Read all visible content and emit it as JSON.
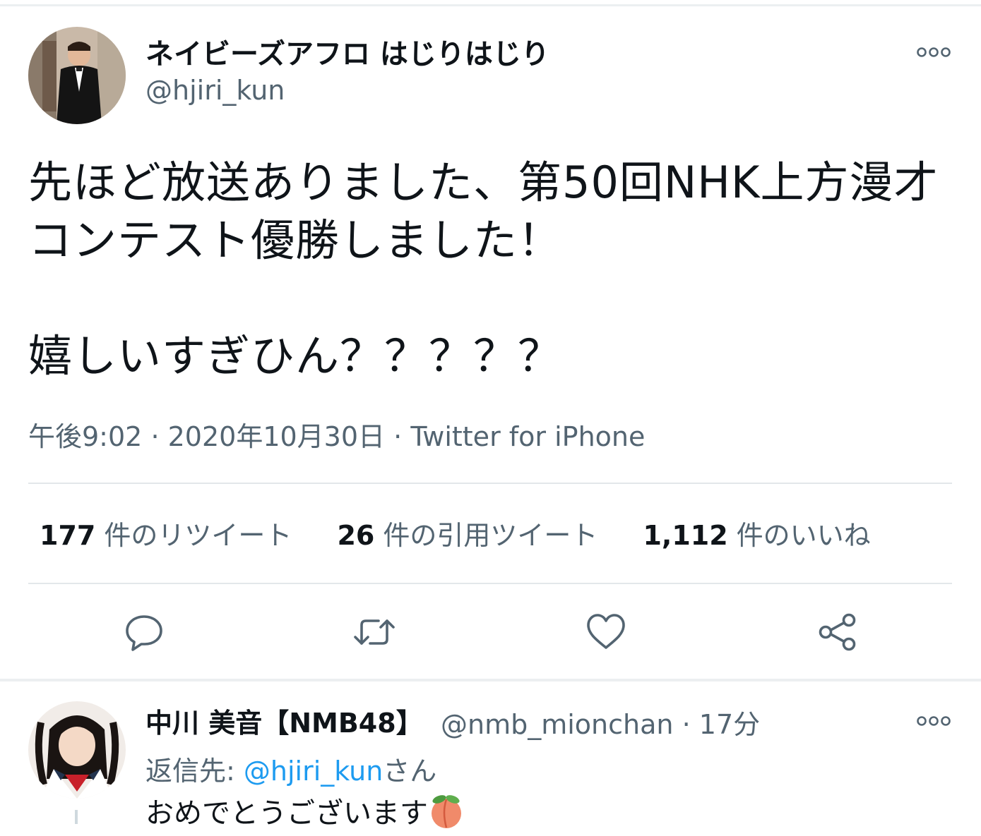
{
  "tweet": {
    "author_name": "ネイビーズアフロ はじりはじり",
    "author_handle": "@hjiri_kun",
    "text_lines": [
      "先ほど放送ありました、第50回NHK上方漫才",
      "コンテスト優勝しました！",
      "嬉しいすぎひん？？？？？"
    ],
    "time": "午後9:02",
    "date": "2020年10月30日",
    "source": "Twitter for iPhone",
    "separator": "·"
  },
  "stats": {
    "retweets_count": "177",
    "retweets_label": "件のリツイート",
    "quotes_count": "26",
    "quotes_label": "件の引用ツイート",
    "likes_count": "1,112",
    "likes_label": "件のいいね"
  },
  "actions": {
    "reply_icon": "reply-icon",
    "retweet_icon": "retweet-icon",
    "like_icon": "heart-icon",
    "share_icon": "share-icon"
  },
  "reply": {
    "author_name": "中川 美音【NMB48】",
    "author_handle": "@nmb_mionchan",
    "time_ago": "17分",
    "separator": "·",
    "reply_to_prefix": "返信先: ",
    "reply_to_mention": "@hjiri_kun",
    "reply_to_suffix": "さん",
    "text": "おめでとうございます",
    "emoji_icon": "peach-icon"
  },
  "colors": {
    "text_primary": "#0f1419",
    "text_secondary": "#536471",
    "accent": "#1d9bf0",
    "divider": "#e3e7ea"
  }
}
